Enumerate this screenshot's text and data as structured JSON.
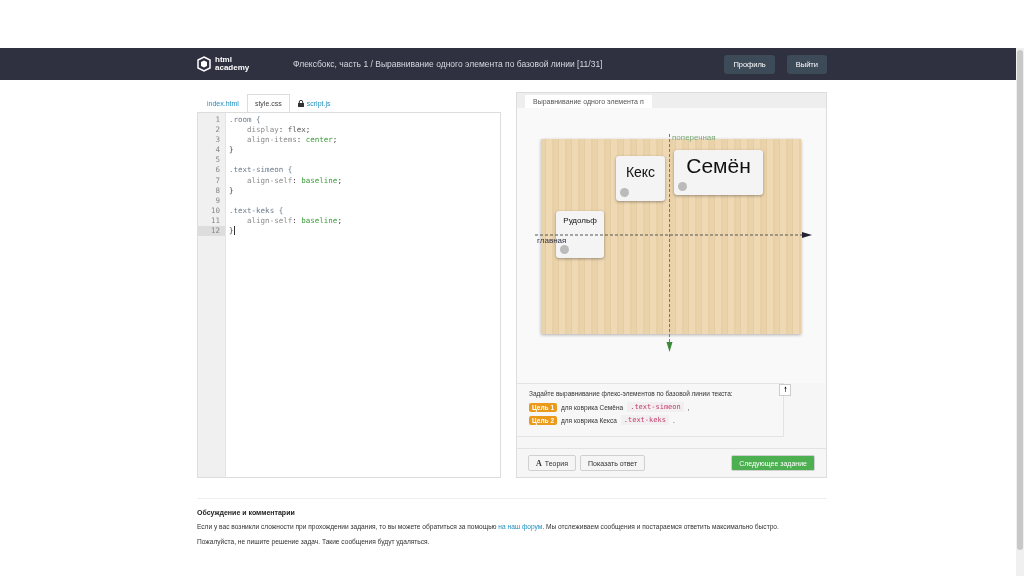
{
  "header": {
    "logo": [
      "html",
      "academy"
    ],
    "breadcrumb": {
      "course": "Флексбокс, часть 1",
      "separator": "/",
      "lesson": "Выравнивание одного элемента по базовой линии",
      "progress": "[11/31]"
    },
    "buttons": [
      "Профиль",
      "Выйти"
    ]
  },
  "editor": {
    "tabs": [
      {
        "label": "index.html",
        "selected": false,
        "locked": false
      },
      {
        "label": "style.css",
        "selected": true,
        "locked": false
      },
      {
        "label": "script.js",
        "selected": false,
        "locked": true
      }
    ],
    "lines": [
      {
        "number": "1",
        "active": false,
        "tokens": [
          {
            "text": ".room {",
            "kind": "selector"
          }
        ]
      },
      {
        "number": "2",
        "active": false,
        "tokens": [
          {
            "text": "    display",
            "kind": "property"
          },
          {
            "text": ": ",
            "kind": "punct"
          },
          {
            "text": "flex",
            "kind": "keyword"
          },
          {
            "text": ";",
            "kind": "punct"
          }
        ]
      },
      {
        "number": "3",
        "active": false,
        "tokens": [
          {
            "text": "    align-items",
            "kind": "property"
          },
          {
            "text": ": ",
            "kind": "punct"
          },
          {
            "text": "center",
            "kind": "value"
          },
          {
            "text": ";",
            "kind": "punct"
          }
        ]
      },
      {
        "number": "4",
        "active": false,
        "tokens": [
          {
            "text": "}",
            "kind": "punct"
          }
        ]
      },
      {
        "number": "5",
        "active": false
      },
      {
        "number": "6",
        "active": false,
        "tokens": [
          {
            "text": ".text-simeon {",
            "kind": "selector"
          }
        ]
      },
      {
        "number": "7",
        "active": false,
        "tokens": [
          {
            "text": "    align-self",
            "kind": "property"
          },
          {
            "text": ": ",
            "kind": "punct"
          },
          {
            "text": "baseline",
            "kind": "value"
          },
          {
            "text": ";",
            "kind": "punct"
          }
        ]
      },
      {
        "number": "8",
        "active": false,
        "tokens": [
          {
            "text": "}",
            "kind": "punct"
          }
        ]
      },
      {
        "number": "9",
        "active": false
      },
      {
        "number": "10",
        "active": false,
        "tokens": [
          {
            "text": ".text-keks {",
            "kind": "selector"
          }
        ]
      },
      {
        "number": "11",
        "active": false,
        "tokens": [
          {
            "text": "    align-self",
            "kind": "property"
          },
          {
            "text": ": ",
            "kind": "punct"
          },
          {
            "text": "baseline",
            "kind": "value"
          },
          {
            "text": ";",
            "kind": "punct"
          }
        ]
      },
      {
        "number": "12",
        "active": true,
        "tokens": [
          {
            "text": "}",
            "kind": "punct"
          }
        ]
      }
    ]
  },
  "preview": {
    "tab": "Выравнивание одного элемента п",
    "axes": {
      "cross": "поперечная",
      "main": "главная"
    },
    "cards": [
      {
        "name": "Рудольф",
        "kind": "small"
      },
      {
        "name": "Кекс",
        "kind": "medium"
      },
      {
        "name": "Семён",
        "kind": "large"
      }
    ]
  },
  "task": {
    "intro": "Задайте выравнивание флекс-элементов по базовой линии текста:",
    "goals": [
      {
        "tag": "Цель 1",
        "text": "для коврика Семёна",
        "code": ".text-simeon",
        "tail": ","
      },
      {
        "tag": "Цель 2",
        "text": "для коврика Кекса",
        "code": ".text-keks",
        "tail": "."
      }
    ],
    "scroll_button": "🠕"
  },
  "actions": {
    "theory_icon": "A",
    "theory": "Теория",
    "show_answer": "Показать ответ",
    "next": "Следующее задание"
  },
  "discussion": {
    "title": "Обсуждение и комментарии",
    "paragraph": {
      "before": "Если у вас возникли сложности при прохождении задания, то вы можете обратиться за помощью ",
      "link": "на наш форум",
      "after": ". Мы отслеживаем сообщения и постараемся ответить максимально быстро."
    },
    "note": "Пожалуйста, не пишите решение задач. Такие сообщения будут удаляться."
  }
}
